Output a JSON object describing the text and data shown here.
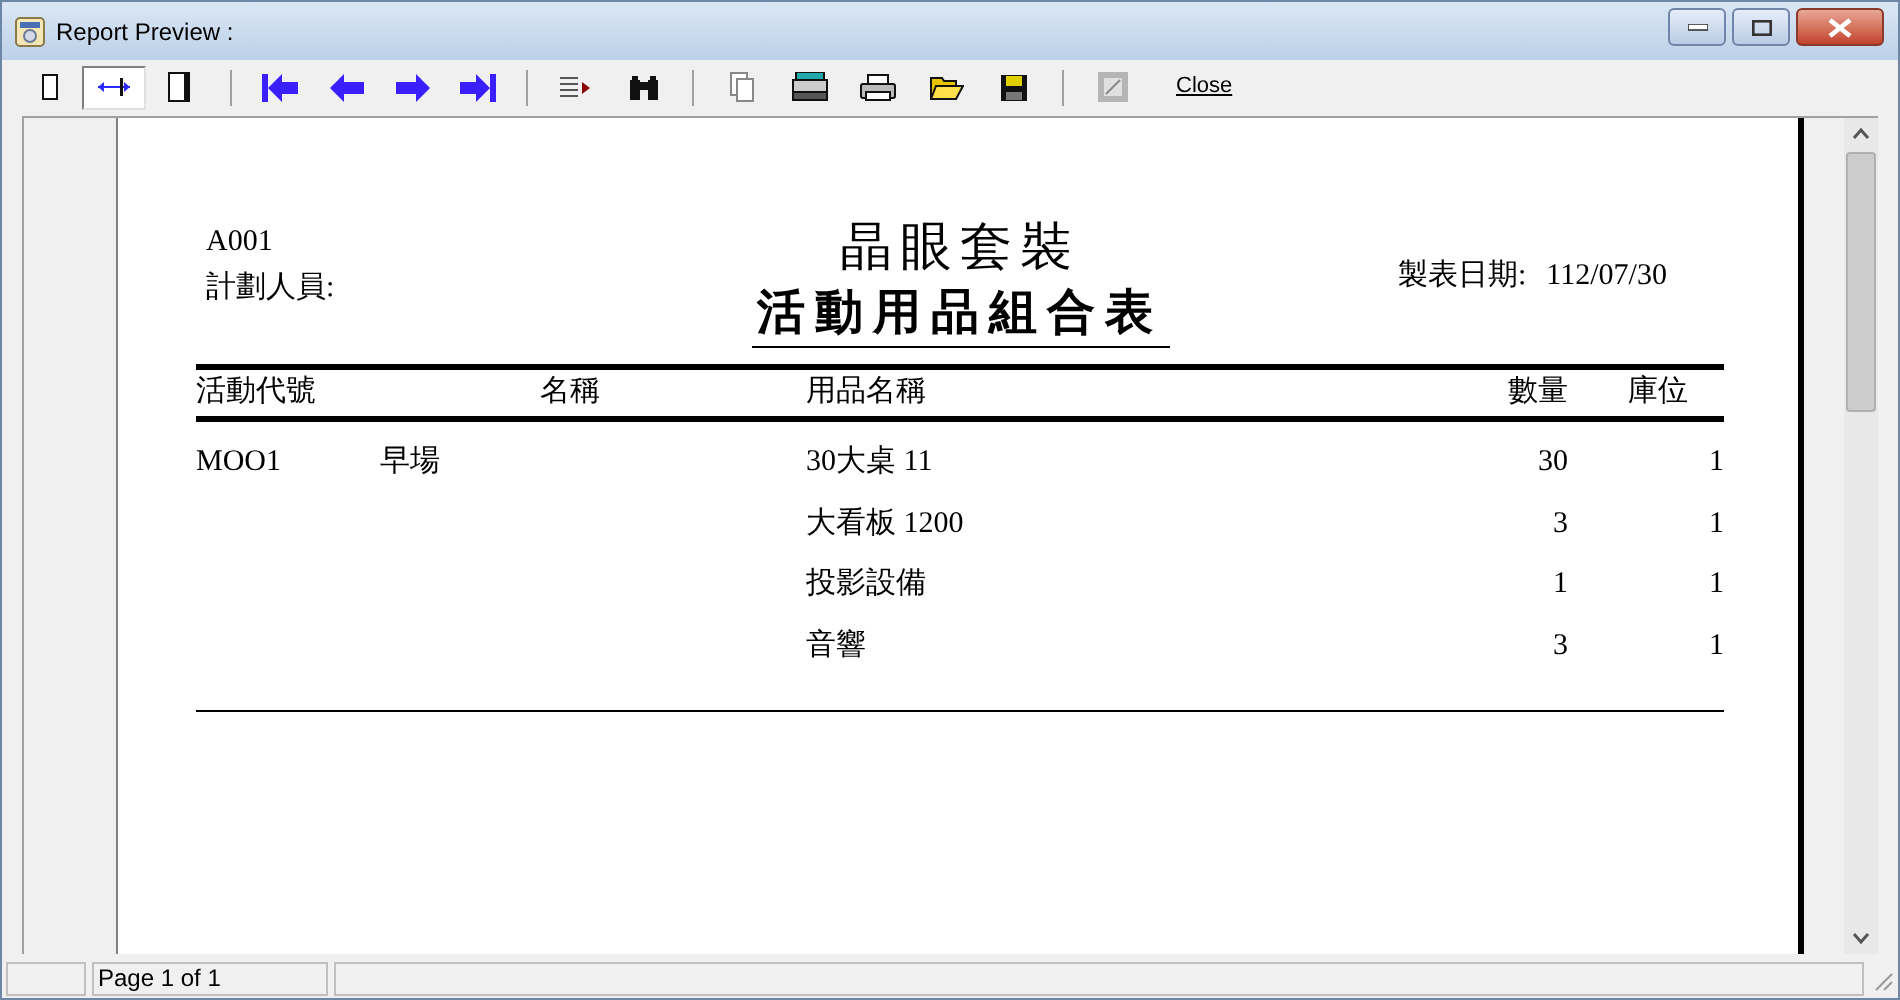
{
  "window": {
    "title": "Report Preview :"
  },
  "toolbar": {
    "view_buttons": [
      {
        "selected": false
      },
      {
        "selected": true
      },
      {
        "selected": false
      }
    ],
    "close_label": "Close"
  },
  "report": {
    "company": "晶眼套裝",
    "title": "活動用品組合表",
    "code": "A001",
    "planner_label": "計劃人員:",
    "date_label": "製表日期:",
    "date": "112/07/30",
    "columns": [
      "活動代號",
      "名稱",
      "用品名稱",
      "數量",
      "庫位"
    ],
    "rows": [
      {
        "activity_code": "MOO1",
        "name": "早場",
        "item": "30大桌 11",
        "quantity": "30",
        "location": "1"
      },
      {
        "item": "大看板 1200",
        "quantity": "3",
        "location": "1"
      },
      {
        "item": "投影設備",
        "quantity": "1",
        "location": "1"
      },
      {
        "item": "音響",
        "quantity": "3",
        "location": "1"
      }
    ]
  },
  "status_bar": {
    "page": "Page 1 of 1"
  }
}
